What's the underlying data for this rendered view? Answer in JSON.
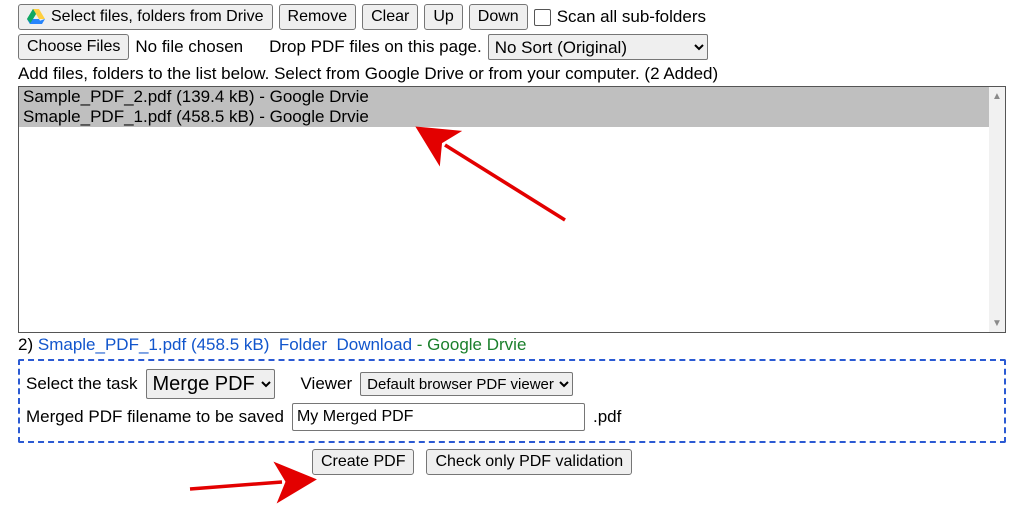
{
  "toolbar": {
    "drive_label": "Select files, folders from Drive",
    "remove": "Remove",
    "clear": "Clear",
    "up": "Up",
    "down": "Down",
    "scan_label": "Scan all sub-folders"
  },
  "fileinput": {
    "choose": "Choose Files",
    "nofile": "No file chosen",
    "drop_hint": "Drop PDF files on this page.",
    "sort_selected": "No Sort (Original)"
  },
  "instructions": "Add files, folders to the list below. Select from Google Drive or from your computer. (2 Added)",
  "files": [
    "Sample_PDF_2.pdf (139.4 kB) - Google Drvie",
    "Smaple_PDF_1.pdf (458.5 kB) - Google Drvie"
  ],
  "status": {
    "index": "2)",
    "name": "Smaple_PDF_1.pdf (458.5 kB)",
    "folder": "Folder",
    "download": "Download",
    "tail": " - Google Drvie"
  },
  "task": {
    "label": "Select the task",
    "selected": "Merge PDF",
    "viewer_label": "Viewer",
    "viewer_selected": "Default browser PDF viewer"
  },
  "filename": {
    "label": "Merged PDF filename to be saved",
    "value": "My Merged PDF",
    "ext": ".pdf"
  },
  "actions": {
    "create": "Create PDF",
    "check": "Check only PDF validation"
  }
}
